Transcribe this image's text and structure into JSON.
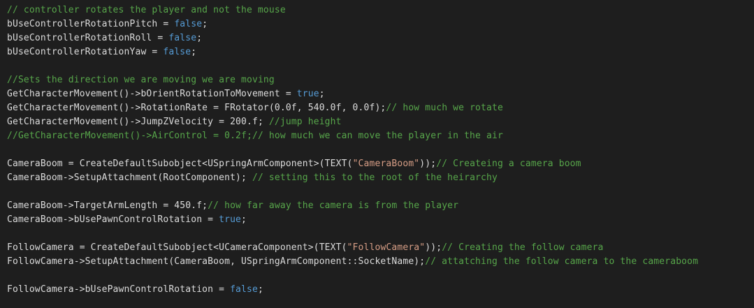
{
  "colors": {
    "background": "#1e1e1e",
    "plain": "#dcdcdc",
    "keyword": "#569cd6",
    "comment": "#57a64a",
    "string": "#d69d85"
  },
  "code_lines": [
    [
      {
        "t": "// controller rotates the player and not the mouse",
        "k": "comment"
      }
    ],
    [
      {
        "t": "bUseControllerRotationPitch = ",
        "k": "plain"
      },
      {
        "t": "false",
        "k": "keyword"
      },
      {
        "t": ";",
        "k": "plain"
      }
    ],
    [
      {
        "t": "bUseControllerRotationRoll = ",
        "k": "plain"
      },
      {
        "t": "false",
        "k": "keyword"
      },
      {
        "t": ";",
        "k": "plain"
      }
    ],
    [
      {
        "t": "bUseControllerRotationYaw = ",
        "k": "plain"
      },
      {
        "t": "false",
        "k": "keyword"
      },
      {
        "t": ";",
        "k": "plain"
      }
    ],
    [],
    [
      {
        "t": "//Sets the direction we are moving we are moving",
        "k": "comment"
      }
    ],
    [
      {
        "t": "GetCharacterMovement()->bOrientRotationToMovement = ",
        "k": "plain"
      },
      {
        "t": "true",
        "k": "keyword"
      },
      {
        "t": ";",
        "k": "plain"
      }
    ],
    [
      {
        "t": "GetCharacterMovement()->RotationRate = FRotator(0.0f, 540.0f, 0.0f);",
        "k": "plain"
      },
      {
        "t": "// how much we rotate",
        "k": "comment"
      }
    ],
    [
      {
        "t": "GetCharacterMovement()->JumpZVelocity = 200.f; ",
        "k": "plain"
      },
      {
        "t": "//jump height",
        "k": "comment"
      }
    ],
    [
      {
        "t": "//GetCharacterMovement()->AirControl = 0.2f;// how much we can move the player in the air",
        "k": "comment"
      }
    ],
    [],
    [
      {
        "t": "CameraBoom = CreateDefaultSubobject<USpringArmComponent>(TEXT(",
        "k": "plain"
      },
      {
        "t": "\"CameraBoom\"",
        "k": "string"
      },
      {
        "t": "));",
        "k": "plain"
      },
      {
        "t": "// Createing a camera boom",
        "k": "comment"
      }
    ],
    [
      {
        "t": "CameraBoom->SetupAttachment(RootComponent); ",
        "k": "plain"
      },
      {
        "t": "// setting this to the root of the heirarchy",
        "k": "comment"
      }
    ],
    [],
    [
      {
        "t": "CameraBoom->TargetArmLength = 450.f;",
        "k": "plain"
      },
      {
        "t": "// how far away the camera is from the player",
        "k": "comment"
      }
    ],
    [
      {
        "t": "CameraBoom->bUsePawnControlRotation = ",
        "k": "plain"
      },
      {
        "t": "true",
        "k": "keyword"
      },
      {
        "t": ";",
        "k": "plain"
      }
    ],
    [],
    [
      {
        "t": "FollowCamera = CreateDefaultSubobject<UCameraComponent>(TEXT(",
        "k": "plain"
      },
      {
        "t": "\"FollowCamera\"",
        "k": "string"
      },
      {
        "t": "));",
        "k": "plain"
      },
      {
        "t": "// Creating the follow camera",
        "k": "comment"
      }
    ],
    [
      {
        "t": "FollowCamera->SetupAttachment(CameraBoom, USpringArmComponent::SocketName);",
        "k": "plain"
      },
      {
        "t": "// attatching the follow camera to the cameraboom",
        "k": "comment"
      }
    ],
    [],
    [
      {
        "t": "FollowCamera->bUsePawnControlRotation = ",
        "k": "plain"
      },
      {
        "t": "false",
        "k": "keyword"
      },
      {
        "t": ";",
        "k": "plain"
      }
    ]
  ]
}
